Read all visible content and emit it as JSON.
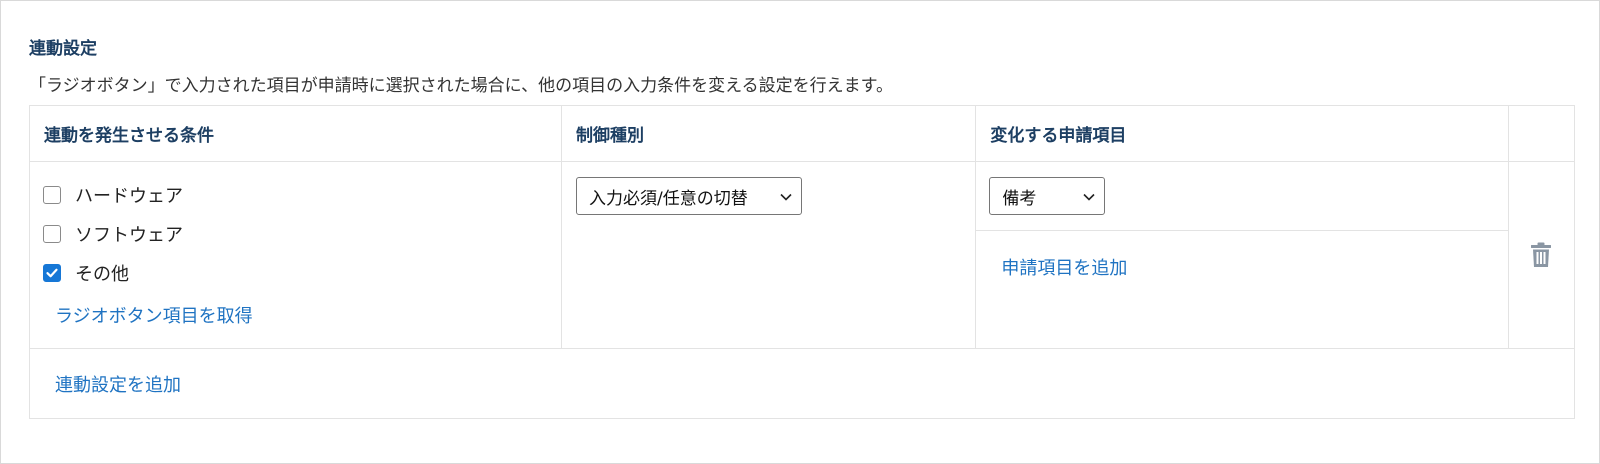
{
  "section": {
    "title": "連動設定",
    "description": "「ラジオボタン」で入力された項目が申請時に選択された場合に、他の項目の入力条件を変える設定を行えます。"
  },
  "table": {
    "headers": [
      "連動を発生させる条件",
      "制御種別",
      "変化する申請項目",
      ""
    ],
    "conditions": [
      {
        "label": "ハードウェア",
        "checked": false
      },
      {
        "label": "ソフトウェア",
        "checked": false
      },
      {
        "label": "その他",
        "checked": true
      }
    ],
    "get_radio_items_link": "ラジオボタン項目を取得",
    "control_type_selected": "入力必須/任意の切替",
    "changed_item_selected": "備考",
    "add_item_link": "申請項目を追加",
    "delete_icon": "trash-icon",
    "add_setting_link": "連動設定を追加"
  },
  "colors": {
    "heading": "#1d3f63",
    "link": "#1f73c2",
    "checkbox_checked": "#1677d6",
    "border": "#e3e3e3",
    "icon_muted": "#8a96a3"
  }
}
